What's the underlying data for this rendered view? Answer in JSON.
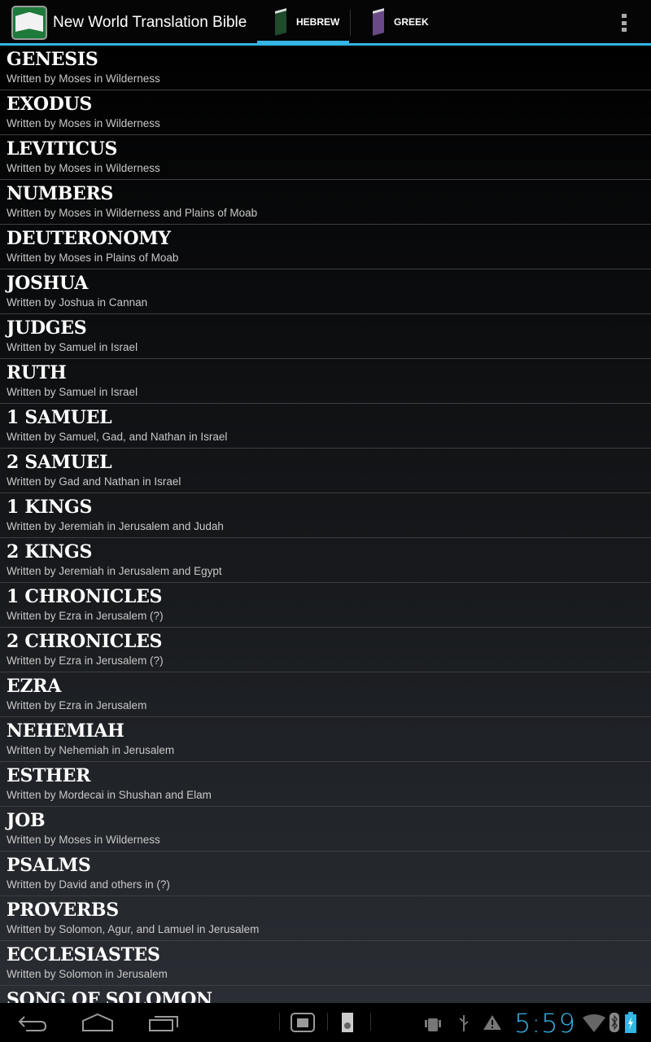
{
  "app": {
    "title": "New World Translation Bible"
  },
  "tabs": [
    {
      "label": "HEBREW",
      "color": "#1f4a2c",
      "selected": true
    },
    {
      "label": "GREEK",
      "color": "#6a4a86",
      "selected": false
    }
  ],
  "books": [
    {
      "title": "GENESIS",
      "subtitle": "Written by Moses in Wilderness"
    },
    {
      "title": "EXODUS",
      "subtitle": "Written by Moses in Wilderness"
    },
    {
      "title": "LEVITICUS",
      "subtitle": "Written by Moses in Wilderness"
    },
    {
      "title": "NUMBERS",
      "subtitle": "Written by Moses in Wilderness and Plains of Moab"
    },
    {
      "title": "DEUTERONOMY",
      "subtitle": "Written by Moses in Plains of Moab"
    },
    {
      "title": "JOSHUA",
      "subtitle": "Written by Joshua in Cannan"
    },
    {
      "title": "JUDGES",
      "subtitle": "Written by Samuel in Israel"
    },
    {
      "title": "RUTH",
      "subtitle": "Written by Samuel in Israel"
    },
    {
      "title": "1 SAMUEL",
      "subtitle": "Written by Samuel, Gad, and Nathan in Israel"
    },
    {
      "title": "2 SAMUEL",
      "subtitle": "Written by Gad and Nathan in Israel"
    },
    {
      "title": "1 KINGS",
      "subtitle": "Written by Jeremiah in Jerusalem and Judah"
    },
    {
      "title": "2 KINGS",
      "subtitle": "Written by Jeremiah in Jerusalem and Egypt"
    },
    {
      "title": "1 CHRONICLES",
      "subtitle": "Written by Ezra in Jerusalem (?)"
    },
    {
      "title": "2 CHRONICLES",
      "subtitle": "Written by Ezra in Jerusalem (?)"
    },
    {
      "title": "EZRA",
      "subtitle": "Written by Ezra in Jerusalem"
    },
    {
      "title": "NEHEMIAH",
      "subtitle": "Written by Nehemiah in Jerusalem"
    },
    {
      "title": "ESTHER",
      "subtitle": "Written by Mordecai in Shushan and Elam"
    },
    {
      "title": "JOB",
      "subtitle": "Written by Moses in Wilderness"
    },
    {
      "title": "PSALMS",
      "subtitle": "Written by David and others in (?)"
    },
    {
      "title": "PROVERBS",
      "subtitle": "Written by Solomon, Agur, and Lamuel in Jerusalem"
    },
    {
      "title": "ECCLESIASTES",
      "subtitle": "Written by Solomon in Jerusalem"
    },
    {
      "title": "SONG OF SOLOMON",
      "subtitle": ""
    }
  ],
  "status": {
    "time": "5:59",
    "accent": "#33b5e5"
  }
}
